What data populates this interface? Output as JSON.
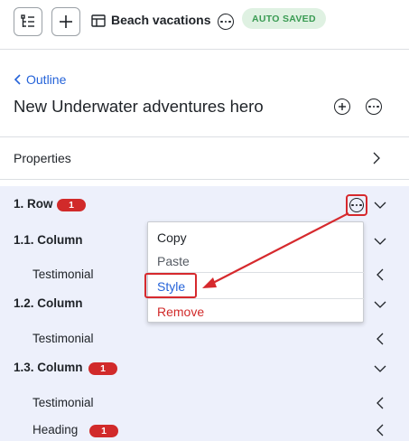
{
  "header": {
    "doc_title": "Beach vacations",
    "status_badge": "AUTO SAVED"
  },
  "nav": {
    "back_link": "Outline",
    "page_title": "New Underwater adventures hero"
  },
  "properties": {
    "label": "Properties"
  },
  "tree": {
    "items": [
      {
        "label": "1. Row",
        "badge": "1"
      },
      {
        "label": "1.1. Column"
      },
      {
        "label": "Testimonial"
      },
      {
        "label": "1.2. Column"
      },
      {
        "label": "Testimonial"
      },
      {
        "label": "1.3. Column",
        "badge": "1"
      },
      {
        "label": "Testimonial"
      },
      {
        "label": "Heading",
        "badge": "1"
      }
    ]
  },
  "context_menu": {
    "items": [
      "Copy",
      "Paste",
      "Style",
      "Remove"
    ]
  },
  "colors": {
    "accent": "#2563d9",
    "danger": "#d12a2a",
    "highlight": "#d6292d",
    "saved_bg": "#dff1e2",
    "saved_text": "#3a9b53",
    "tree_bg": "#edf0fb"
  },
  "icons": [
    "outline-tree-icon",
    "plus-icon",
    "document-icon",
    "more-icon",
    "chevron-left-icon",
    "chevron-right-icon",
    "chevron-down-icon",
    "plus-circle-icon"
  ]
}
